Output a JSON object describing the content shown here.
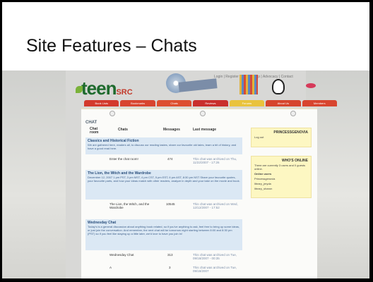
{
  "slide_title": "Site Features – Chats",
  "site": {
    "logo_main": "teen",
    "logo_sub": "SRC",
    "top_links": "Login | Register | Links | Help | Advocacy | Contact"
  },
  "nav": [
    {
      "label": "Book Lists",
      "color": "#d33a2c"
    },
    {
      "label": "Bookmarks",
      "color": "#d8452f"
    },
    {
      "label": "Chats",
      "color": "#dd4f2f"
    },
    {
      "label": "Reviews",
      "color": "#c9302c"
    },
    {
      "label": "Forums",
      "color": "#e9c33c"
    },
    {
      "label": "About Us",
      "color": "#d6452c"
    },
    {
      "label": "Members",
      "color": "#d8452f"
    }
  ],
  "chat": {
    "heading": "CHAT",
    "headers": {
      "room": "Chat room",
      "chats": "Chats",
      "messages": "Messages",
      "last": "Last message"
    },
    "sections": [
      {
        "title": "Classics and Historical Fiction",
        "desc": "We are gathered here, readers all, to discuss our reading tastes, share our favourite old tales, learn a bit of history, and have a good read here.",
        "rows": [
          {
            "name": "Enter the chat room!",
            "messages": "474",
            "last": "This chat was archived on Thu, 11/22/2007 - 17:26"
          }
        ]
      },
      {
        "title": "The Lion, the Witch and the Wardrobe",
        "desc": "December 12, 2007 1 pm PST, 3 pm MST, 4 pm CST, 5 pm EST, 6 pm AST, 8:30 pm NST Share your favourite quotes, your favourite parts, and how your ideas match with other readers, analyze in depth and your take on the movie and book.",
        "rows": [
          {
            "name": "The Lion, the Witch, and the Wardrobe",
            "messages": "10545",
            "last": "This chat was archived on Wed, 12/12/2007 - 17:52"
          }
        ]
      },
      {
        "title": "Wednesday Chat",
        "desc": "Today's is a general discussion about anything book related, so if you've anything to ask, feel free to bring up some ideas, or just join the conversation. And remember, the next chat will be tomorrow night starting between 8:00 and 8:30 pm (PST) so if you feel like staying up a little later, we'd love to have you join in!",
        "rows": [
          {
            "name": "Wednesday Chat",
            "messages": "313",
            "last": "This chat was archived on Tue, 09/18/2007 - 00:35"
          },
          {
            "name": "A",
            "messages": "3",
            "last": "This chat was archived on Tue, 09/18/2007"
          }
        ]
      }
    ]
  },
  "sidebar": {
    "user_title": "PRINCESSGENOVIA",
    "user_link": "Log out",
    "online_title": "WHO'S ONLINE",
    "online_desc": "There are currently 3 users and 0 guests online.",
    "online_label": "Online users",
    "users": [
      "Princessgenovia",
      "library_jmyda",
      "library_sharon"
    ]
  },
  "colors": {
    "section_bg": "#dbe8f4",
    "section_title": "#2a4f7d",
    "sidebar_bg": "#fdf7c2",
    "logo_green": "#1f6b2e"
  }
}
